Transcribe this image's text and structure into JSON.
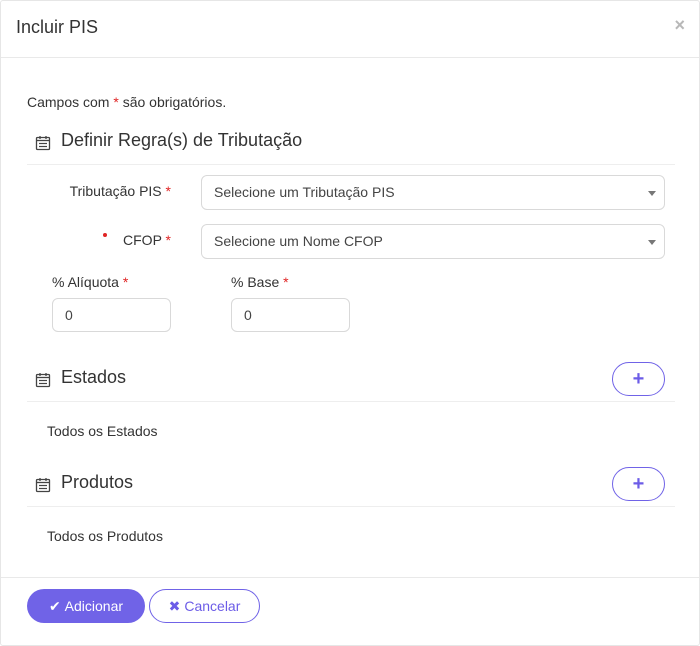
{
  "modal": {
    "title": "Incluir PIS",
    "close_glyph": "×",
    "required_note_prefix": "Campos com ",
    "required_note_star": "*",
    "required_note_suffix": " são obrigatórios."
  },
  "tax_rules": {
    "title": "Definir Regra(s) de Tributação",
    "icon": "calendar-list-icon",
    "tributacao_label": "Tributação PIS",
    "tributacao_selected": "Selecione um Tributação PIS",
    "cfop_label": "CFOP",
    "cfop_selected": "Selecione um Nome CFOP",
    "aliquota_label": "% Alíquota",
    "aliquota_value": "0",
    "base_label": "% Base",
    "base_value": "0",
    "required_star": "*"
  },
  "estados": {
    "title": "Estados",
    "icon": "calendar-list-icon",
    "add_label": "+",
    "content": "Todos os Estados"
  },
  "produtos": {
    "title": "Produtos",
    "icon": "calendar-list-icon",
    "add_label": "+",
    "content": "Todos os Produtos"
  },
  "footer": {
    "add_icon": "✔",
    "add_label": "Adicionar",
    "cancel_icon": "✖",
    "cancel_label": "Cancelar"
  },
  "colors": {
    "accent": "#7063e7",
    "required": "#e02424"
  }
}
